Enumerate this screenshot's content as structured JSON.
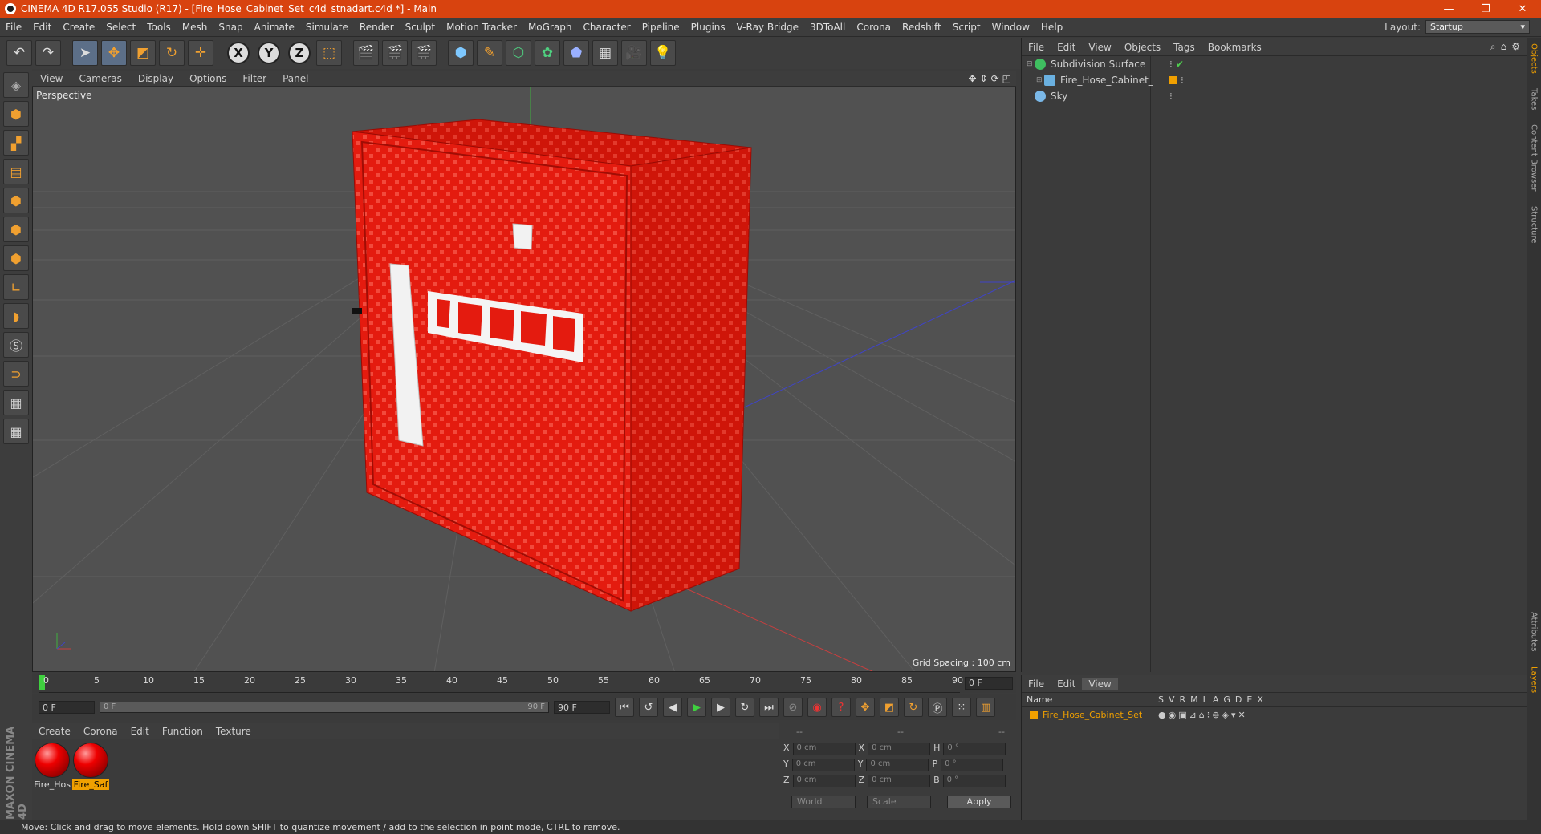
{
  "titlebar": {
    "title": "CINEMA 4D R17.055 Studio (R17) - [Fire_Hose_Cabinet_Set_c4d_stnadart.c4d *] - Main",
    "minimize": "—",
    "restore": "❐",
    "close": "✕"
  },
  "menu": [
    "File",
    "Edit",
    "Create",
    "Select",
    "Tools",
    "Mesh",
    "Snap",
    "Animate",
    "Simulate",
    "Render",
    "Sculpt",
    "Motion Tracker",
    "MoGraph",
    "Character",
    "Pipeline",
    "Plugins",
    "V-Ray Bridge",
    "3DToAll",
    "Corona",
    "Redshift",
    "Script",
    "Window",
    "Help"
  ],
  "layout": {
    "label": "Layout:",
    "value": "Startup"
  },
  "toolbar": {
    "axis_x": "X",
    "axis_y": "Y",
    "axis_z": "Z"
  },
  "viewport": {
    "menu": [
      "View",
      "Cameras",
      "Display",
      "Options",
      "Filter",
      "Panel"
    ],
    "label": "Perspective",
    "grid_spacing": "Grid Spacing : 100 cm"
  },
  "timeline": {
    "ticks": [
      "0",
      "5",
      "10",
      "15",
      "20",
      "25",
      "30",
      "35",
      "40",
      "45",
      "50",
      "55",
      "60",
      "65",
      "70",
      "75",
      "80",
      "85",
      "90"
    ],
    "current_frame": "0 F",
    "start": "0 F",
    "slider_start": "0 F",
    "slider_end": "90 F",
    "end": "90 F"
  },
  "material_menu": [
    "Create",
    "Corona",
    "Edit",
    "Function",
    "Texture"
  ],
  "materials": [
    {
      "name": "Fire_Hos"
    },
    {
      "name": "Fire_Saf"
    }
  ],
  "coords": {
    "headers": [
      "--",
      "--",
      "--"
    ],
    "rows": [
      {
        "a": "X",
        "av": "0 cm",
        "b": "X",
        "bv": "0 cm",
        "c": "H",
        "cv": "0 °"
      },
      {
        "a": "Y",
        "av": "0 cm",
        "b": "Y",
        "bv": "0 cm",
        "c": "P",
        "cv": "0 °"
      },
      {
        "a": "Z",
        "av": "0 cm",
        "b": "Z",
        "bv": "0 cm",
        "c": "B",
        "cv": "0 °"
      }
    ],
    "world": "World",
    "scale": "Scale",
    "apply": "Apply"
  },
  "objects_menu": [
    "File",
    "Edit",
    "View",
    "Objects",
    "Tags",
    "Bookmarks"
  ],
  "objects": [
    {
      "name": "Subdivision Surface"
    },
    {
      "name": "Fire_Hose_Cabinet_Set"
    },
    {
      "name": "Sky"
    }
  ],
  "attr_menu": [
    "File",
    "Edit",
    "View"
  ],
  "attr_header": {
    "name": "Name",
    "cols": [
      "S",
      "V",
      "R",
      "M",
      "L",
      "A",
      "G",
      "D",
      "E",
      "X"
    ]
  },
  "attr_row": "Fire_Hose_Cabinet_Set",
  "right_tabs": [
    "Objects",
    "Takes",
    "Content Browser",
    "Structure",
    "Attributes",
    "Layers"
  ],
  "status": "Move: Click and drag to move elements. Hold down SHIFT to quantize movement / add to the selection in point mode, CTRL to remove.",
  "brand": "MAXON CINEMA 4D",
  "colors": {
    "title_bar": "#d8430f",
    "accent": "#f0a000",
    "cabinet": "#e41b0f"
  }
}
